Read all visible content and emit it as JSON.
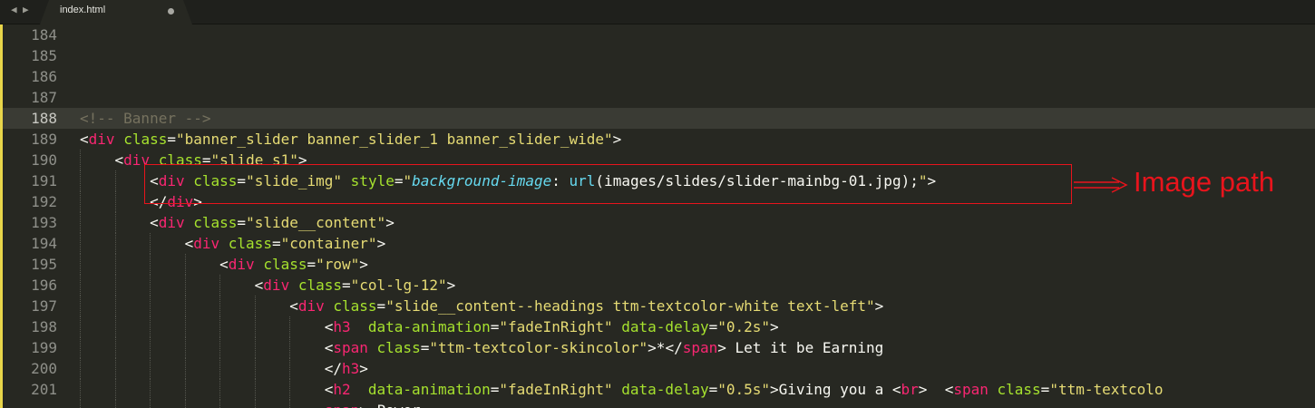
{
  "tabs": [
    {
      "label": "index.html",
      "modified": true
    }
  ],
  "editor": {
    "current_line": "188",
    "lines": [
      {
        "num": "184",
        "tokens": []
      },
      {
        "num": "185",
        "tokens": []
      },
      {
        "num": "186",
        "tokens": []
      },
      {
        "num": "187",
        "tokens": []
      },
      {
        "num": "188",
        "tokens": [
          {
            "t": "<!-- Banner -->",
            "c": "comment"
          }
        ]
      },
      {
        "num": "189",
        "tokens": [
          {
            "t": "<",
            "c": "plain"
          },
          {
            "t": "div",
            "c": "tag"
          },
          {
            "t": " ",
            "c": "plain"
          },
          {
            "t": "class",
            "c": "attr"
          },
          {
            "t": "=",
            "c": "plain"
          },
          {
            "t": "\"banner_slider banner_slider_1 banner_slider_wide\"",
            "c": "string"
          },
          {
            "t": ">",
            "c": "plain"
          }
        ]
      },
      {
        "num": "190",
        "tokens": [
          {
            "t": "    <",
            "c": "plain"
          },
          {
            "t": "div",
            "c": "tag"
          },
          {
            "t": " ",
            "c": "plain"
          },
          {
            "t": "class",
            "c": "attr"
          },
          {
            "t": "=",
            "c": "plain"
          },
          {
            "t": "\"slide s1\"",
            "c": "string"
          },
          {
            "t": ">",
            "c": "plain"
          }
        ]
      },
      {
        "num": "191",
        "tokens": [
          {
            "t": "        <",
            "c": "plain"
          },
          {
            "t": "div",
            "c": "tag"
          },
          {
            "t": " ",
            "c": "plain"
          },
          {
            "t": "class",
            "c": "attr"
          },
          {
            "t": "=",
            "c": "plain"
          },
          {
            "t": "\"slide_img\"",
            "c": "string"
          },
          {
            "t": " ",
            "c": "plain"
          },
          {
            "t": "style",
            "c": "attr"
          },
          {
            "t": "=",
            "c": "plain"
          },
          {
            "t": "\"",
            "c": "string"
          },
          {
            "t": "background-image",
            "c": "prop"
          },
          {
            "t": ": ",
            "c": "plain"
          },
          {
            "t": "url",
            "c": "func"
          },
          {
            "t": "(images/slides/slider-mainbg-01.jpg);",
            "c": "plain"
          },
          {
            "t": "\"",
            "c": "string"
          },
          {
            "t": ">",
            "c": "plain"
          }
        ]
      },
      {
        "num": "192",
        "tokens": [
          {
            "t": "        </",
            "c": "plain"
          },
          {
            "t": "div",
            "c": "tag"
          },
          {
            "t": ">",
            "c": "plain"
          }
        ]
      },
      {
        "num": "193",
        "tokens": [
          {
            "t": "        <",
            "c": "plain"
          },
          {
            "t": "div",
            "c": "tag"
          },
          {
            "t": " ",
            "c": "plain"
          },
          {
            "t": "class",
            "c": "attr"
          },
          {
            "t": "=",
            "c": "plain"
          },
          {
            "t": "\"slide__content\"",
            "c": "string"
          },
          {
            "t": ">",
            "c": "plain"
          }
        ]
      },
      {
        "num": "194",
        "tokens": [
          {
            "t": "            <",
            "c": "plain"
          },
          {
            "t": "div",
            "c": "tag"
          },
          {
            "t": " ",
            "c": "plain"
          },
          {
            "t": "class",
            "c": "attr"
          },
          {
            "t": "=",
            "c": "plain"
          },
          {
            "t": "\"container\"",
            "c": "string"
          },
          {
            "t": ">",
            "c": "plain"
          }
        ]
      },
      {
        "num": "195",
        "tokens": [
          {
            "t": "                <",
            "c": "plain"
          },
          {
            "t": "div",
            "c": "tag"
          },
          {
            "t": " ",
            "c": "plain"
          },
          {
            "t": "class",
            "c": "attr"
          },
          {
            "t": "=",
            "c": "plain"
          },
          {
            "t": "\"row\"",
            "c": "string"
          },
          {
            "t": ">",
            "c": "plain"
          }
        ]
      },
      {
        "num": "196",
        "tokens": [
          {
            "t": "                    <",
            "c": "plain"
          },
          {
            "t": "div",
            "c": "tag"
          },
          {
            "t": " ",
            "c": "plain"
          },
          {
            "t": "class",
            "c": "attr"
          },
          {
            "t": "=",
            "c": "plain"
          },
          {
            "t": "\"col-lg-12\"",
            "c": "string"
          },
          {
            "t": ">",
            "c": "plain"
          }
        ]
      },
      {
        "num": "197",
        "tokens": [
          {
            "t": "                        <",
            "c": "plain"
          },
          {
            "t": "div",
            "c": "tag"
          },
          {
            "t": " ",
            "c": "plain"
          },
          {
            "t": "class",
            "c": "attr"
          },
          {
            "t": "=",
            "c": "plain"
          },
          {
            "t": "\"slide__content--headings ttm-textcolor-white text-left\"",
            "c": "string"
          },
          {
            "t": ">",
            "c": "plain"
          }
        ]
      },
      {
        "num": "198",
        "tokens": [
          {
            "t": "                            <",
            "c": "plain"
          },
          {
            "t": "h3",
            "c": "tag"
          },
          {
            "t": "  ",
            "c": "plain"
          },
          {
            "t": "data-animation",
            "c": "attr"
          },
          {
            "t": "=",
            "c": "plain"
          },
          {
            "t": "\"fadeInRight\"",
            "c": "string"
          },
          {
            "t": " ",
            "c": "plain"
          },
          {
            "t": "data-delay",
            "c": "attr"
          },
          {
            "t": "=",
            "c": "plain"
          },
          {
            "t": "\"0.2s\"",
            "c": "string"
          },
          {
            "t": ">",
            "c": "plain"
          }
        ]
      },
      {
        "num": "199",
        "tokens": [
          {
            "t": "                            <",
            "c": "plain"
          },
          {
            "t": "span",
            "c": "tag"
          },
          {
            "t": " ",
            "c": "plain"
          },
          {
            "t": "class",
            "c": "attr"
          },
          {
            "t": "=",
            "c": "plain"
          },
          {
            "t": "\"ttm-textcolor-skincolor\"",
            "c": "string"
          },
          {
            "t": ">*</",
            "c": "plain"
          },
          {
            "t": "span",
            "c": "tag"
          },
          {
            "t": "> Let it be Earning",
            "c": "plain"
          }
        ]
      },
      {
        "num": "200",
        "tokens": [
          {
            "t": "                            </",
            "c": "plain"
          },
          {
            "t": "h3",
            "c": "tag"
          },
          {
            "t": ">",
            "c": "plain"
          }
        ]
      },
      {
        "num": "201",
        "tokens": [
          {
            "t": "                            <",
            "c": "plain"
          },
          {
            "t": "h2",
            "c": "tag"
          },
          {
            "t": "  ",
            "c": "plain"
          },
          {
            "t": "data-animation",
            "c": "attr"
          },
          {
            "t": "=",
            "c": "plain"
          },
          {
            "t": "\"fadeInRight\"",
            "c": "string"
          },
          {
            "t": " ",
            "c": "plain"
          },
          {
            "t": "data-delay",
            "c": "attr"
          },
          {
            "t": "=",
            "c": "plain"
          },
          {
            "t": "\"0.5s\"",
            "c": "string"
          },
          {
            "t": ">Giving you a <",
            "c": "plain"
          },
          {
            "t": "br",
            "c": "tag"
          },
          {
            "t": ">  <",
            "c": "plain"
          },
          {
            "t": "span",
            "c": "tag"
          },
          {
            "t": " ",
            "c": "plain"
          },
          {
            "t": "class",
            "c": "attr"
          },
          {
            "t": "=",
            "c": "plain"
          },
          {
            "t": "\"ttm-textcolo",
            "c": "string"
          }
        ]
      },
      {
        "num": "",
        "tokens": [
          {
            "t": "                            ",
            "c": "plain"
          },
          {
            "t": "span",
            "c": "tag"
          },
          {
            "t": "> Power",
            "c": "plain"
          }
        ]
      }
    ]
  },
  "annotation": {
    "label": "Image path",
    "color": "#e8141c"
  }
}
